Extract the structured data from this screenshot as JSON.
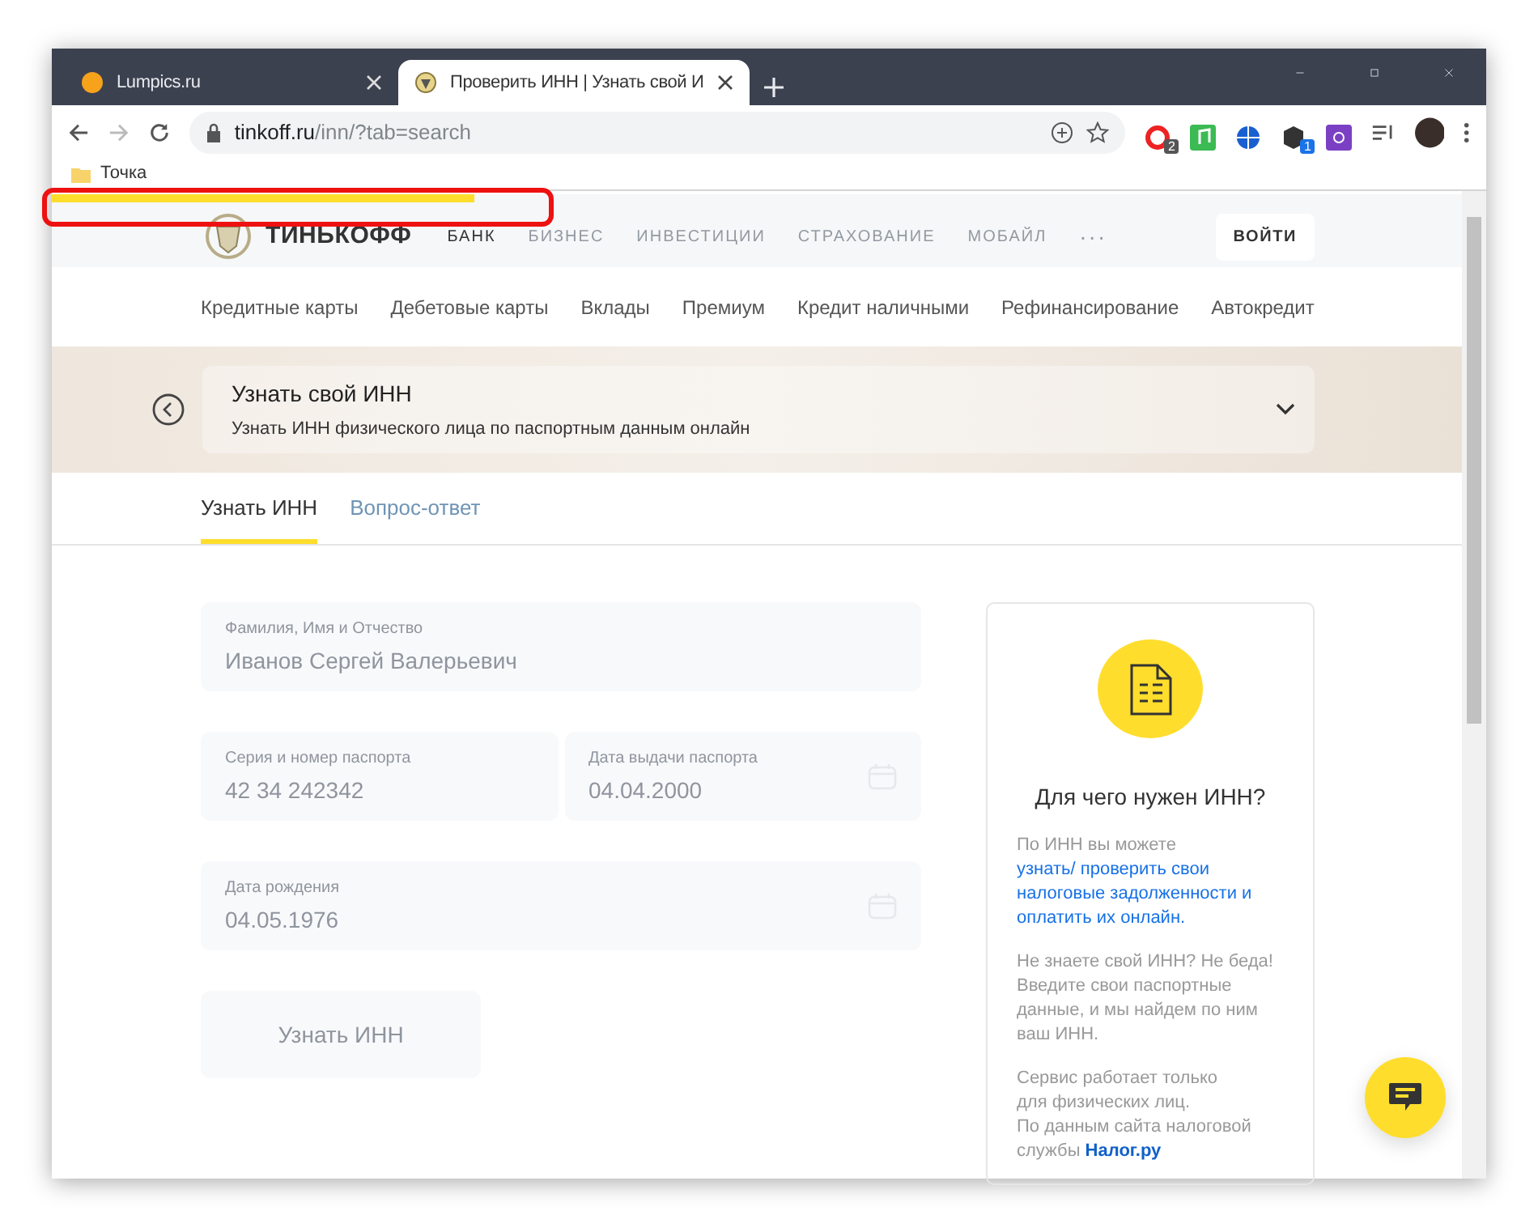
{
  "browser": {
    "tabs": [
      {
        "title": "Lumpics.ru",
        "selected": false
      },
      {
        "title": "Проверить ИНН | Узнать свой И",
        "selected": true
      }
    ],
    "address": {
      "host": "tinkoff.ru",
      "path": "/inn/?tab=search"
    },
    "extension_badges": [
      "2",
      "1"
    ],
    "bookmarks": [
      "Точка"
    ],
    "page_loading": {
      "level": 0.3
    }
  },
  "site_nav": {
    "logo": "ТИНЬКОФФ",
    "items": [
      {
        "label": "БАНК",
        "selected": true
      },
      {
        "label": "БИЗНЕС",
        "selected": false
      },
      {
        "label": "ИНВЕСТИЦИИ",
        "selected": false
      },
      {
        "label": "СТРАХОВАНИЕ",
        "selected": false
      },
      {
        "label": "МОБАЙЛ",
        "selected": false
      }
    ],
    "more": "···",
    "login": "ВОЙТИ"
  },
  "sub_nav": [
    "Кредитные карты",
    "Дебетовые карты",
    "Вклады",
    "Премиум",
    "Кредит наличными",
    "Рефинансирование",
    "Автокредит"
  ],
  "banner": {
    "title": "Узнать свой ИНН",
    "subtitle": "Узнать ИНН физического лица по паспортным данным онлайн"
  },
  "page_tabs": [
    {
      "label": "Узнать ИНН",
      "selected": true
    },
    {
      "label": "Вопрос-ответ",
      "selected": false
    }
  ],
  "form": {
    "rows": [
      [
        {
          "kind": "text",
          "label": "Фамилия, Имя и Отчество",
          "value": "Иванов Сергей Валерьевич"
        }
      ],
      [
        {
          "kind": "text",
          "label": "Серия и номер паспорта",
          "value": "42 34 242342"
        },
        {
          "kind": "date",
          "label": "Дата выдачи паспорта",
          "value": "04.04.2000"
        }
      ],
      [
        {
          "kind": "date",
          "label": "Дата рождения",
          "value": "04.05.1976"
        }
      ]
    ],
    "submit": {
      "label": "Узнать ИНН",
      "disabled": true
    }
  },
  "info_card": {
    "title": "Для чего нужен ИНН?",
    "paragraphs": [
      {
        "text": "По ИНН вы можете ",
        "link": "узнать/ проверить свои налоговые задолженности и оплатить их онлайн.",
        "link_bold": false
      },
      {
        "text": "Не знаете свой ИНН? Не беда! Введите свои паспортные данные, и мы найдем по ним ваш ИНН."
      },
      {
        "text": "Сервис работает только\nдля физических лиц.\nПо данным сайта налоговой\nслужбы ",
        "link": "Налог.ру",
        "link_bold": true
      }
    ]
  }
}
